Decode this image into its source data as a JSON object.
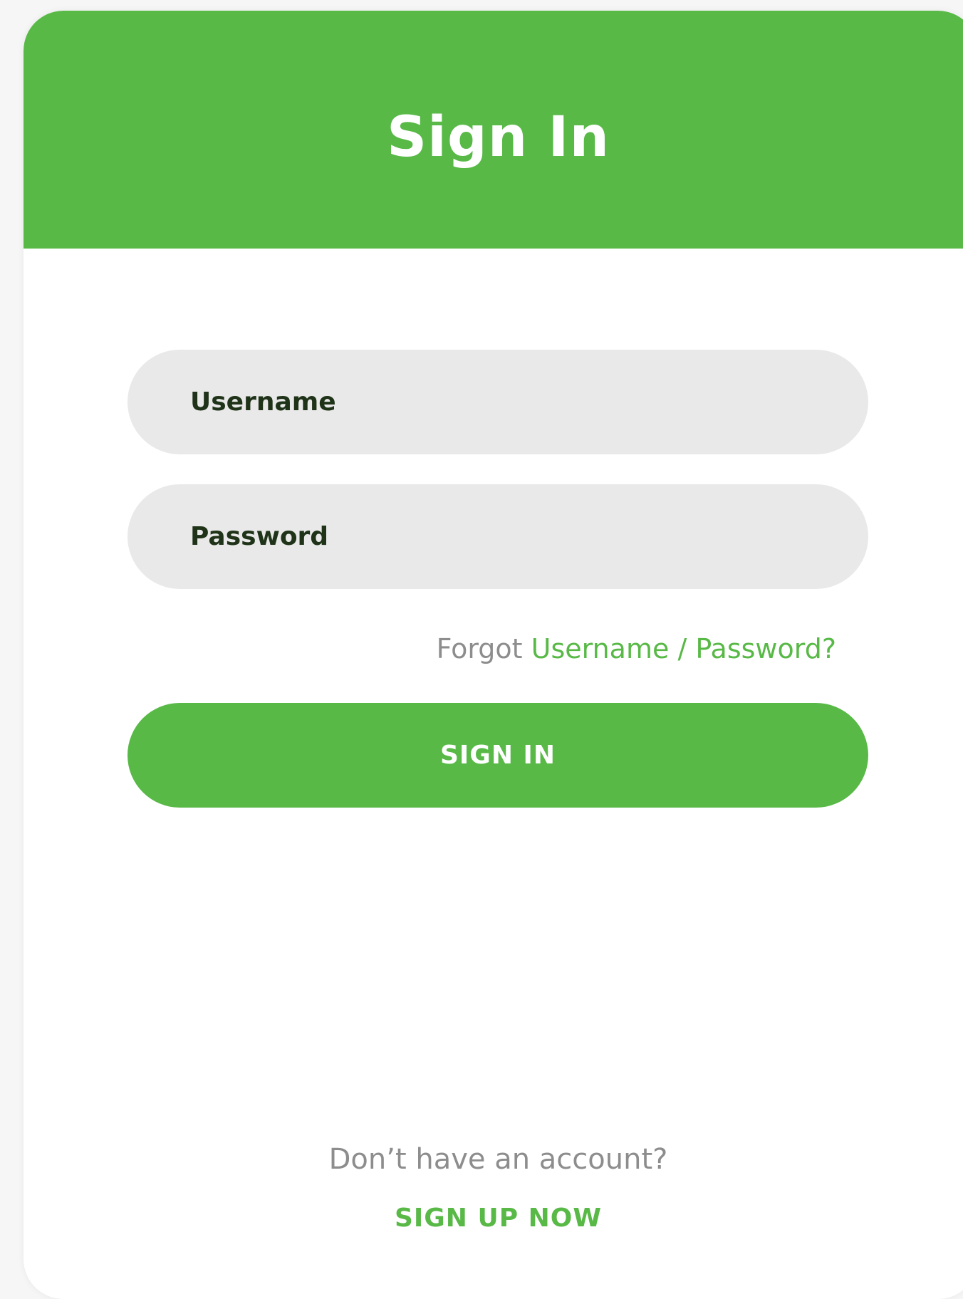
{
  "colors": {
    "brand_green": "#58b947",
    "field_bg": "#e9e9e9",
    "muted_text": "#8d8d8d",
    "field_text": "#1f3318"
  },
  "header": {
    "title": "Sign In"
  },
  "form": {
    "username_placeholder": "Username",
    "password_placeholder": "Password",
    "forgot_prefix": "Forgot",
    "forgot_link": "Username / Password?",
    "submit_label": "SIGN IN"
  },
  "footer": {
    "prompt": "Don’t have an account?",
    "signup_label": "SIGN UP NOW"
  }
}
